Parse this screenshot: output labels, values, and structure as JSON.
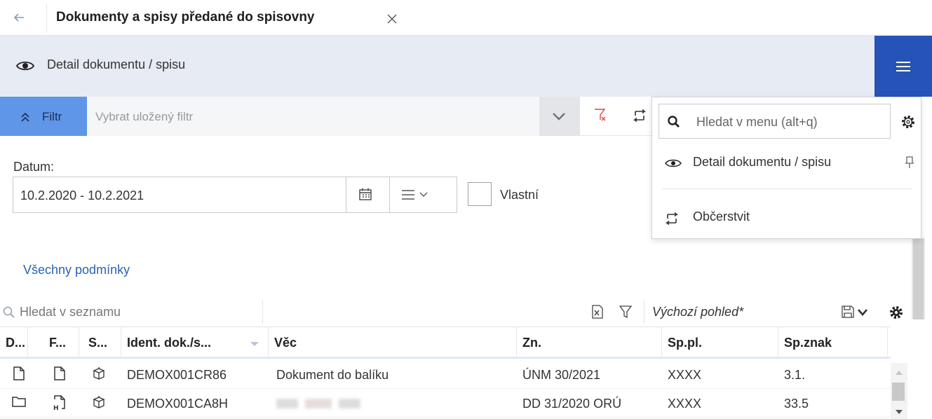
{
  "tab": {
    "title": "Dokumenty a spisy předané do spisovny"
  },
  "toolbar": {
    "detail_label": "Detail dokumentu / spisu"
  },
  "filter": {
    "button_label": "Filtr",
    "saved_placeholder": "Vybrat uložený filtr"
  },
  "date": {
    "label": "Datum:",
    "value": "10.2.2020 - 10.2.2021",
    "custom_label": "Vlastní"
  },
  "conditions_link": "Všechny podmínky",
  "list": {
    "search_placeholder": "Hledat v seznamu",
    "view_name": "Výchozí pohled*"
  },
  "table": {
    "columns": [
      "D...",
      "F...",
      "S...",
      "Ident. dok./s...",
      "Věc",
      "Zn.",
      "Sp.pl.",
      "Sp.znak"
    ],
    "rows": [
      {
        "ident": "DEMOX001CR86",
        "vec": "Dokument do balíku",
        "zn": "ÚNM 30/2021",
        "sppl": "XXXX",
        "spznak": "3.1."
      },
      {
        "ident": "DEMOX001CA8H",
        "vec": "",
        "zn": "DD 31/2020 ORÚ",
        "sppl": "XXXX",
        "spznak": "33.5"
      }
    ]
  },
  "menu": {
    "search_placeholder": "Hledat v menu (alt+q)",
    "items": [
      {
        "label": "Detail dokumentu / spisu",
        "icon": "eye-icon"
      },
      {
        "label": "Občerstvit",
        "icon": "refresh-icon"
      }
    ]
  },
  "colors": {
    "accent": "#2553b8",
    "filter_button": "#5f96e8",
    "toolbar_bg": "#e7ebf3",
    "link": "#2b62b6",
    "clear_filter": "#e0443b"
  }
}
